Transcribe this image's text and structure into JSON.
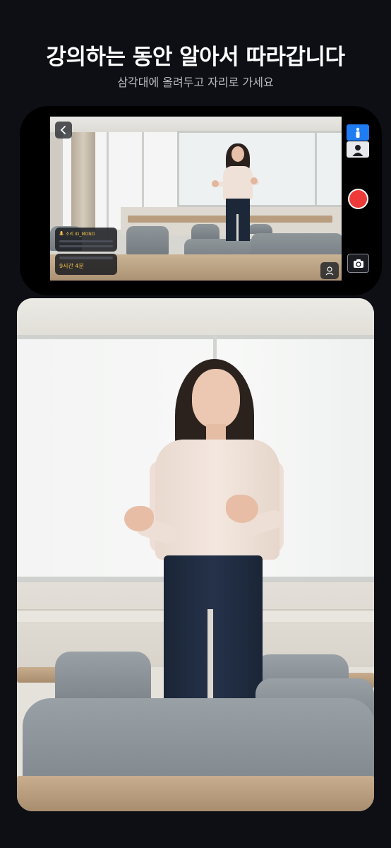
{
  "header": {
    "title": "강의하는 동안 알아서 따라갑니다",
    "subtitle": "삼각대에 올려두고 자리로 가세요"
  },
  "preview": {
    "audio_label": "소리 ID_MONO",
    "recording_time": "9시간 4분"
  },
  "controls": {
    "mode_top": "person-tracking-icon",
    "mode_bottom": "portrait-icon",
    "record": "record-icon",
    "switch_camera": "camera-switch-icon"
  },
  "colors": {
    "background": "#0d0f14",
    "accent_blue": "#1f7cf2",
    "record_red": "#ef3a3a",
    "highlight_yellow": "#f3c14a"
  }
}
